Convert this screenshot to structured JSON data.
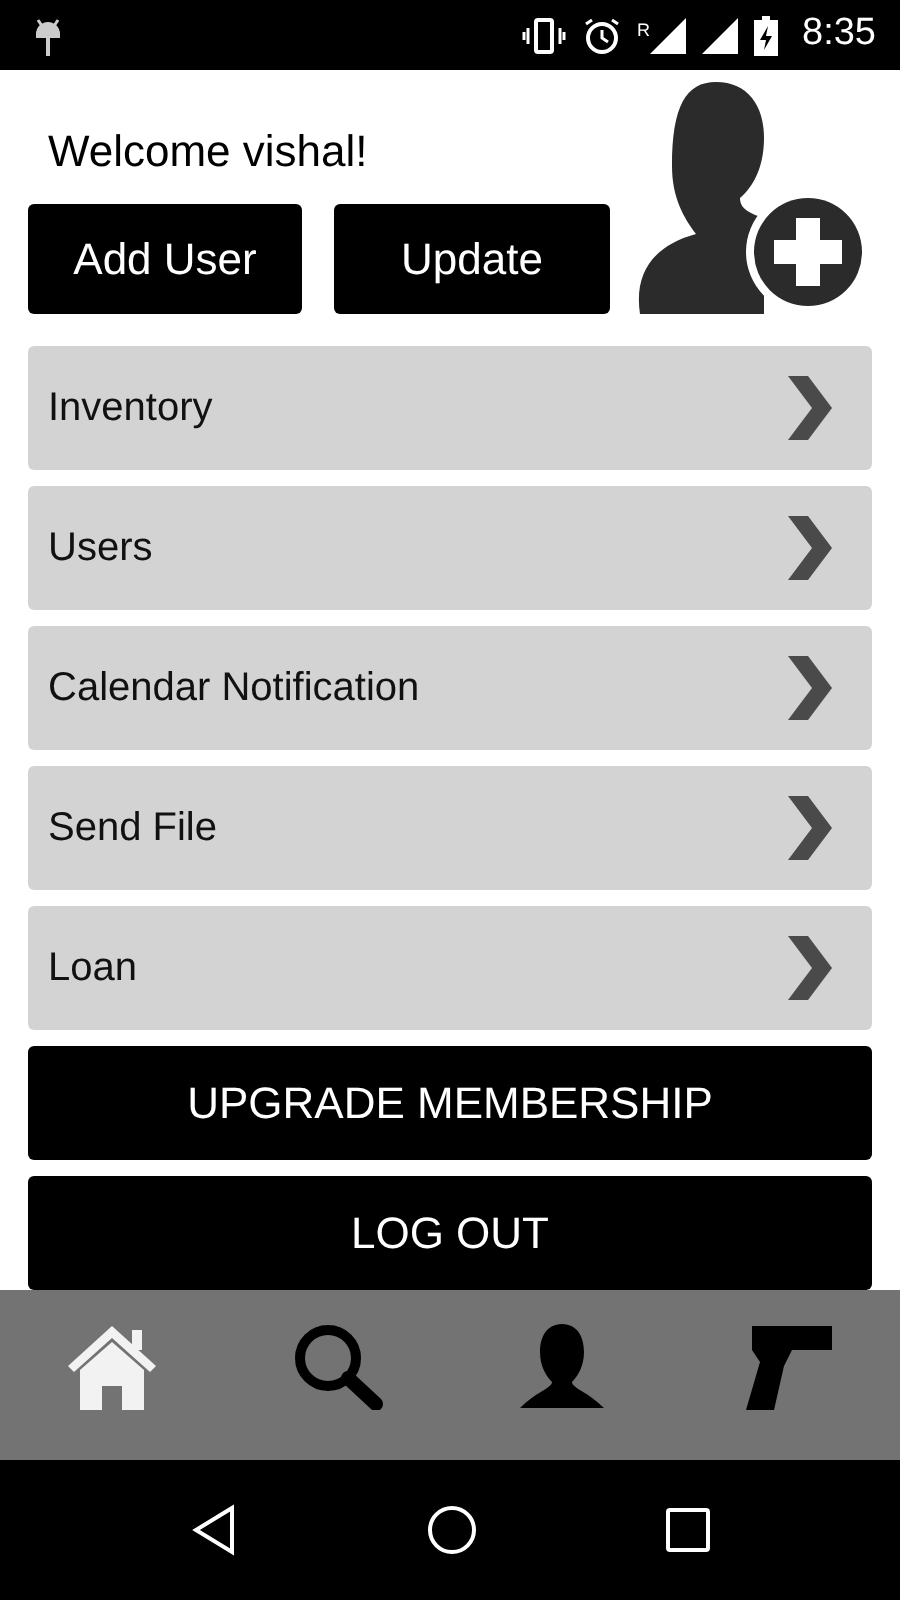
{
  "status_bar": {
    "time": "8:35",
    "roaming": "R"
  },
  "welcome": "Welcome vishal!",
  "buttons": [
    "Add User",
    "Update"
  ],
  "menu": [
    {
      "label": "Inventory"
    },
    {
      "label": "Users"
    },
    {
      "label": "Calendar Notification"
    },
    {
      "label": "Send File"
    },
    {
      "label": "Loan"
    }
  ],
  "actions": [
    "UPGRADE MEMBERSHIP",
    "LOG OUT"
  ],
  "tabs": [
    {
      "kind": "home",
      "selected": true
    },
    {
      "kind": "search",
      "selected": false
    },
    {
      "kind": "person",
      "selected": false
    },
    {
      "kind": "pistol",
      "selected": false
    }
  ]
}
